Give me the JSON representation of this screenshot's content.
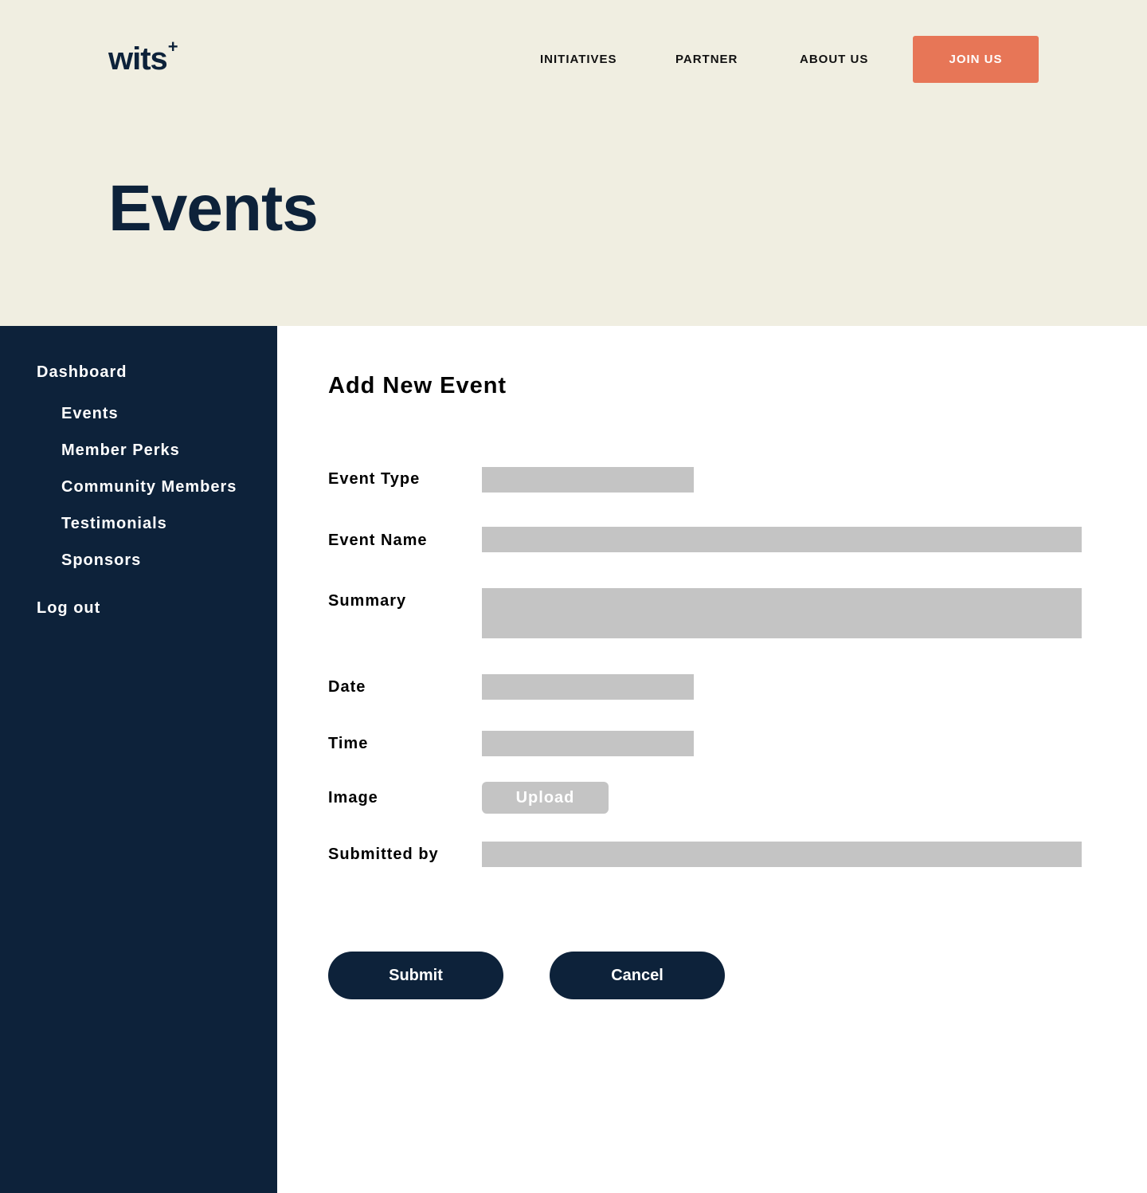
{
  "header": {
    "logo_text": "wits",
    "logo_mark": "+",
    "nav": [
      {
        "label": "INITIATIVES"
      },
      {
        "label": "PARTNER"
      },
      {
        "label": "ABOUT US"
      }
    ],
    "join_label": "JOIN US",
    "page_title": "Events"
  },
  "sidebar": {
    "dashboard": "Dashboard",
    "items": [
      {
        "label": "Events"
      },
      {
        "label": "Member Perks"
      },
      {
        "label": "Community Members"
      },
      {
        "label": "Testimonials"
      },
      {
        "label": "Sponsors"
      }
    ],
    "logout": "Log out"
  },
  "form": {
    "title": "Add New Event",
    "labels": {
      "event_type": "Event Type",
      "event_name": "Event Name",
      "summary": "Summary",
      "date": "Date",
      "time": "Time",
      "image": "Image",
      "submitted_by": "Submitted by"
    },
    "values": {
      "event_type": "",
      "event_name": "",
      "summary": "",
      "date": "",
      "time": "",
      "submitted_by": ""
    },
    "upload_label": "Upload",
    "submit_label": "Submit",
    "cancel_label": "Cancel"
  },
  "colors": {
    "hero_background": "#f0eee1",
    "navy": "#0d223a",
    "accent": "#e77657",
    "field_gray": "#c4c4c4"
  }
}
